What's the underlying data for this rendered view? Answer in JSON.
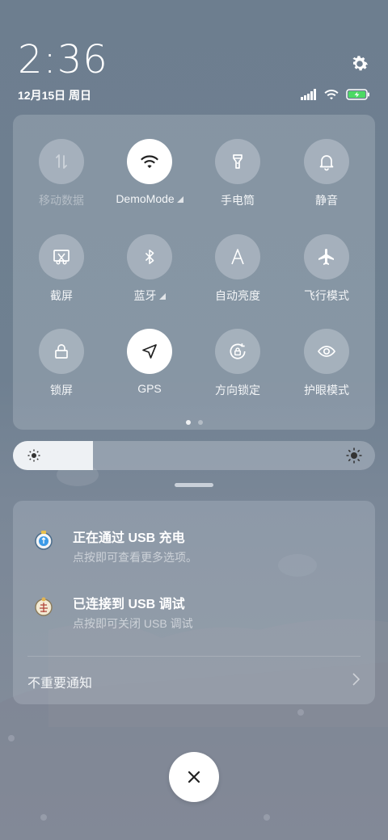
{
  "status": {
    "time": "2:36",
    "date": "12月15日 周日",
    "icons": [
      "signal-icon",
      "wifi-icon",
      "battery-charging-icon"
    ]
  },
  "quick_settings": {
    "tiles": [
      {
        "label": "移动数据",
        "icon": "mobile-data-icon",
        "on": false,
        "disabled": true
      },
      {
        "label": "DemoMode",
        "icon": "wifi-icon",
        "on": true,
        "expandable": true
      },
      {
        "label": "手电筒",
        "icon": "flashlight-icon",
        "on": false
      },
      {
        "label": "静音",
        "icon": "bell-icon",
        "on": false
      },
      {
        "label": "截屏",
        "icon": "screenshot-icon",
        "on": false
      },
      {
        "label": "蓝牙",
        "icon": "bluetooth-icon",
        "on": false,
        "expandable": true
      },
      {
        "label": "自动亮度",
        "icon": "auto-brightness-icon",
        "on": false
      },
      {
        "label": "飞行模式",
        "icon": "airplane-icon",
        "on": false
      },
      {
        "label": "锁屏",
        "icon": "lock-icon",
        "on": false
      },
      {
        "label": "GPS",
        "icon": "location-arrow-icon",
        "on": true
      },
      {
        "label": "方向锁定",
        "icon": "rotation-lock-icon",
        "on": false
      },
      {
        "label": "护眼模式",
        "icon": "eye-icon",
        "on": false
      }
    ],
    "page_count": 2,
    "current_page": 1
  },
  "brightness": {
    "level": 0.22
  },
  "notifications": [
    {
      "title": "正在通过 USB 充电",
      "subtitle": "点按即可查看更多选项。",
      "icon": "usb-charging-icon"
    },
    {
      "title": "已连接到 USB 调试",
      "subtitle": "点按即可关闭 USB 调试",
      "icon": "usb-debug-icon"
    }
  ],
  "minor_notifications": {
    "label": "不重要通知"
  },
  "colors": {
    "tile_on": "#ffffff",
    "accent_battery": "#4cd964"
  }
}
